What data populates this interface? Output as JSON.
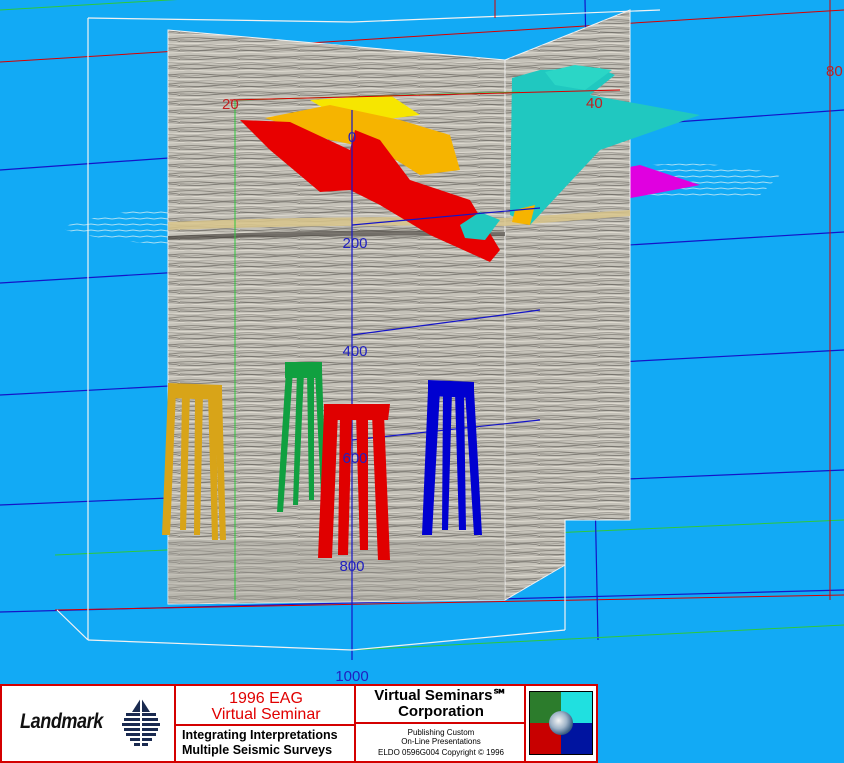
{
  "scene": {
    "colors": {
      "background": "#12aaf5",
      "grid_blue": "#1414c8",
      "grid_red": "#d80000",
      "grid_green": "#2ec83c",
      "frame_white": "#f2f2f2",
      "panel_gray": "#bdbab2",
      "horizon_red": "#e80000",
      "horizon_orange": "#f6b400",
      "horizon_yellow": "#f6e600",
      "horizon_cyan": "#20c8c0",
      "horizon_magenta": "#e000e0",
      "well_gold": "#d8a418",
      "well_green": "#10a040",
      "well_red": "#e00000",
      "well_blue": "#0000d0"
    },
    "depth_labels": [
      "0",
      "200",
      "400",
      "600",
      "800",
      "1000"
    ],
    "trace_labels": [
      "20",
      "40",
      "80"
    ]
  },
  "banner": {
    "company": "Landmark",
    "logo_icon": "landmark-arch-icon",
    "seminar_year": "1996 EAG",
    "seminar_name": "Virtual Seminar",
    "topic_line1": "Integrating Interpretations",
    "topic_line2": "Multiple Seismic Surveys",
    "vs_name": "Virtual Seminars℠",
    "vs_corp": "Corporation",
    "publishing_line1": "Publishing Custom",
    "publishing_line2": "On-Line Presentations",
    "copyright": "ELDO 0596G004 Copyright © 1996",
    "vs_logo_icon": "globe-quadrant-icon",
    "logo_colors": [
      "#2c7c2c",
      "#20e0e0",
      "#c80000",
      "#0014a0"
    ]
  }
}
